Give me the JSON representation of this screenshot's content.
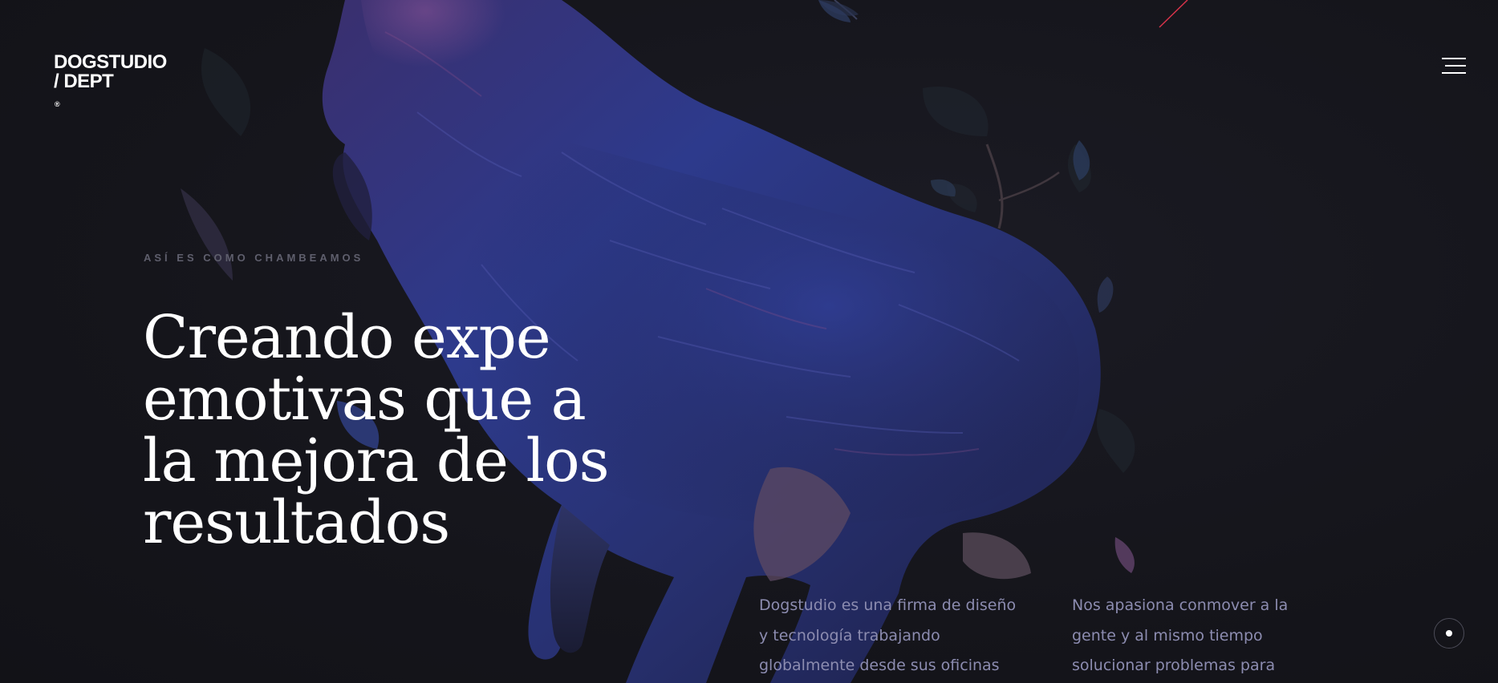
{
  "header": {
    "logo_line1": "DOGSTUDIO",
    "logo_line2": "/ DEPT",
    "logo_mark": "®",
    "menu_icon": "hamburger-menu-icon"
  },
  "hero": {
    "eyebrow": "ASÍ ES COMO CHAMBEAMOS",
    "headline_lines": [
      "Creando expe",
      "emotivas que a",
      "la mejora de los",
      "resultados"
    ],
    "illustration_icon": "wolf-illustration"
  },
  "body": {
    "col1_lines": [
      "Dogstudio es una firma de diseño",
      "y tecnología trabajando",
      "globalmente desde sus oficinas"
    ],
    "col2_lines": [
      "Nos apasiona conmover a la",
      "gente y al mismo tiempo",
      "solucionar problemas para"
    ]
  },
  "scroll_indicator": {
    "icon": "scroll-dot-icon"
  },
  "colors": {
    "background": "#15151b",
    "headline": "#ffffff",
    "eyebrow": "#5f5f6d",
    "body_text": "#8c8cb0",
    "accent_line": "#d8334a",
    "wolf_fur": "#2b3275"
  }
}
